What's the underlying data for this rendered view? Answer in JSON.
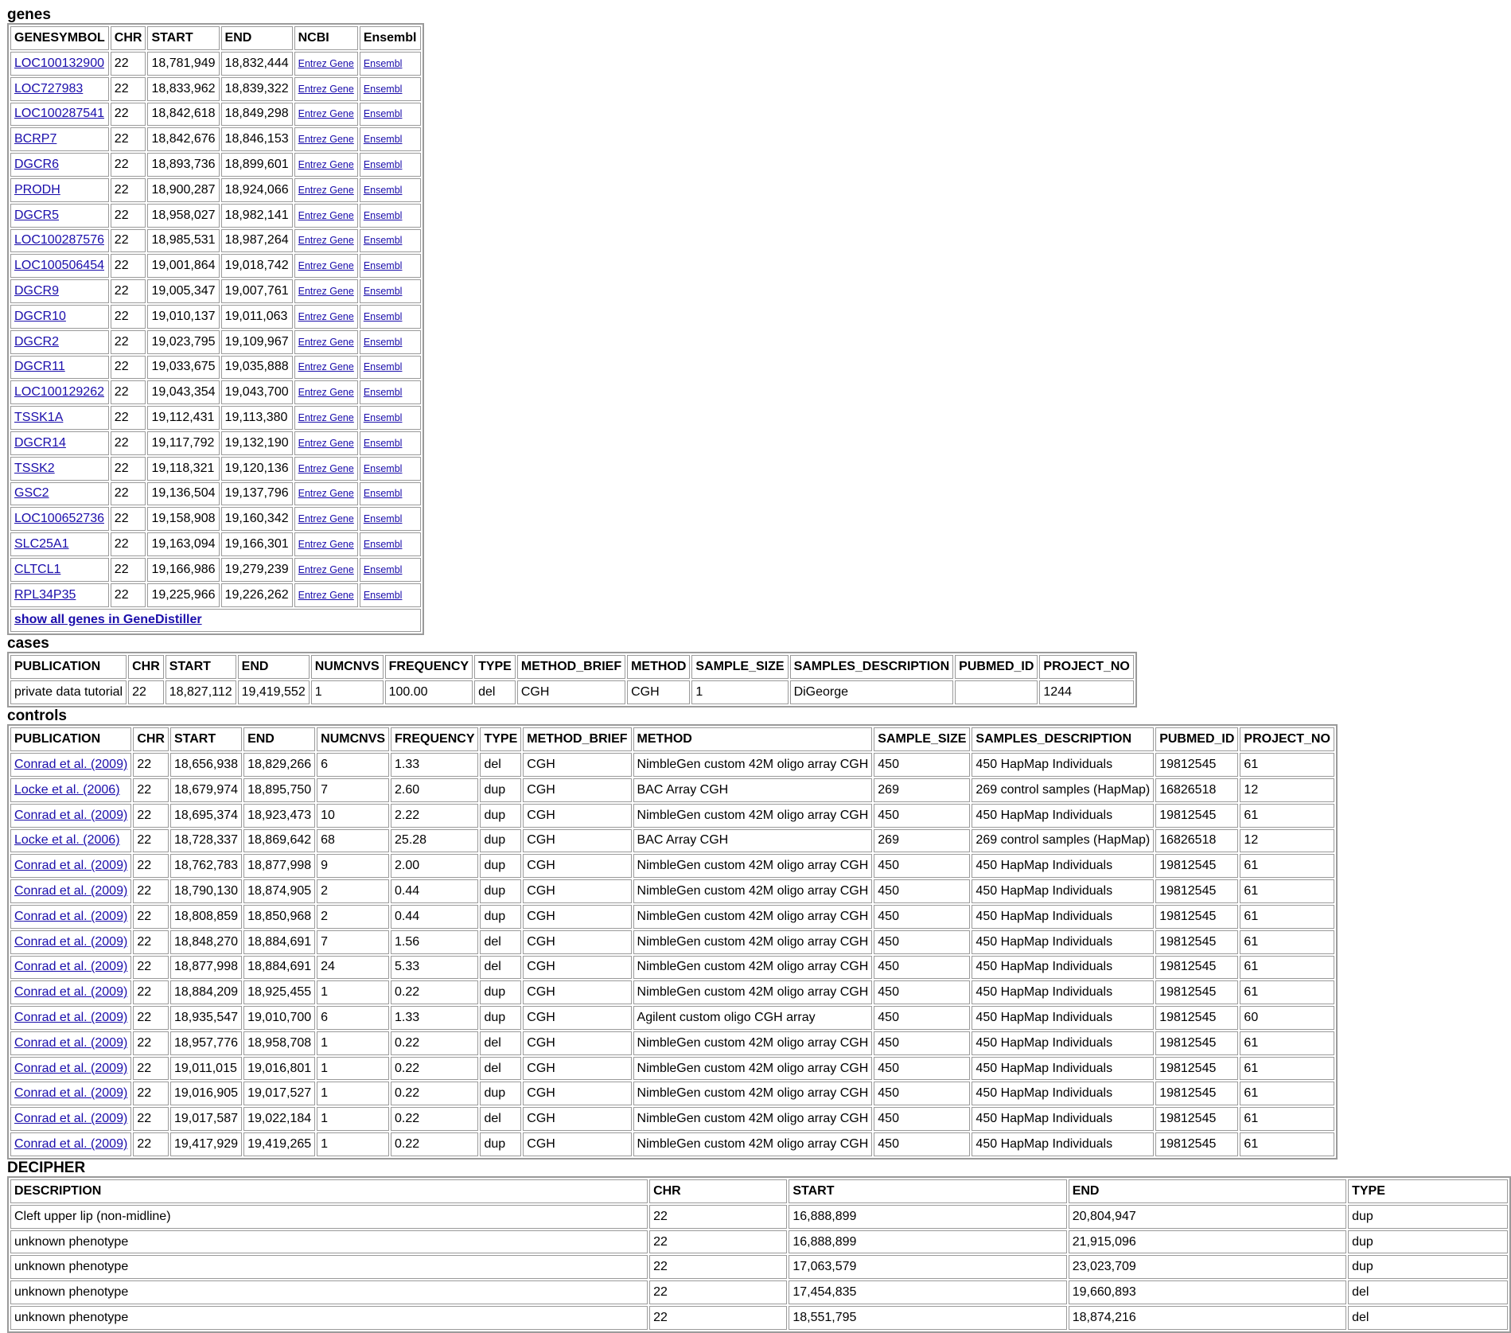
{
  "genes": {
    "title": "genes",
    "headers": [
      "GENESYMBOL",
      "CHR",
      "START",
      "END",
      "NCBI",
      "Ensembl"
    ],
    "rows": [
      {
        "symbol": "LOC100132900",
        "chr": "22",
        "start": "18,781,949",
        "end": "18,832,444",
        "ncbi": "Entrez Gene",
        "ensembl": "Ensembl"
      },
      {
        "symbol": "LOC727983",
        "chr": "22",
        "start": "18,833,962",
        "end": "18,839,322",
        "ncbi": "Entrez Gene",
        "ensembl": "Ensembl"
      },
      {
        "symbol": "LOC100287541",
        "chr": "22",
        "start": "18,842,618",
        "end": "18,849,298",
        "ncbi": "Entrez Gene",
        "ensembl": "Ensembl"
      },
      {
        "symbol": "BCRP7",
        "chr": "22",
        "start": "18,842,676",
        "end": "18,846,153",
        "ncbi": "Entrez Gene",
        "ensembl": "Ensembl"
      },
      {
        "symbol": "DGCR6",
        "chr": "22",
        "start": "18,893,736",
        "end": "18,899,601",
        "ncbi": "Entrez Gene",
        "ensembl": "Ensembl"
      },
      {
        "symbol": "PRODH",
        "chr": "22",
        "start": "18,900,287",
        "end": "18,924,066",
        "ncbi": "Entrez Gene",
        "ensembl": "Ensembl"
      },
      {
        "symbol": "DGCR5",
        "chr": "22",
        "start": "18,958,027",
        "end": "18,982,141",
        "ncbi": "Entrez Gene",
        "ensembl": "Ensembl"
      },
      {
        "symbol": "LOC100287576",
        "chr": "22",
        "start": "18,985,531",
        "end": "18,987,264",
        "ncbi": "Entrez Gene",
        "ensembl": "Ensembl"
      },
      {
        "symbol": "LOC100506454",
        "chr": "22",
        "start": "19,001,864",
        "end": "19,018,742",
        "ncbi": "Entrez Gene",
        "ensembl": "Ensembl"
      },
      {
        "symbol": "DGCR9",
        "chr": "22",
        "start": "19,005,347",
        "end": "19,007,761",
        "ncbi": "Entrez Gene",
        "ensembl": "Ensembl"
      },
      {
        "symbol": "DGCR10",
        "chr": "22",
        "start": "19,010,137",
        "end": "19,011,063",
        "ncbi": "Entrez Gene",
        "ensembl": "Ensembl"
      },
      {
        "symbol": "DGCR2",
        "chr": "22",
        "start": "19,023,795",
        "end": "19,109,967",
        "ncbi": "Entrez Gene",
        "ensembl": "Ensembl"
      },
      {
        "symbol": "DGCR11",
        "chr": "22",
        "start": "19,033,675",
        "end": "19,035,888",
        "ncbi": "Entrez Gene",
        "ensembl": "Ensembl"
      },
      {
        "symbol": "LOC100129262",
        "chr": "22",
        "start": "19,043,354",
        "end": "19,043,700",
        "ncbi": "Entrez Gene",
        "ensembl": "Ensembl"
      },
      {
        "symbol": "TSSK1A",
        "chr": "22",
        "start": "19,112,431",
        "end": "19,113,380",
        "ncbi": "Entrez Gene",
        "ensembl": "Ensembl"
      },
      {
        "symbol": "DGCR14",
        "chr": "22",
        "start": "19,117,792",
        "end": "19,132,190",
        "ncbi": "Entrez Gene",
        "ensembl": "Ensembl"
      },
      {
        "symbol": "TSSK2",
        "chr": "22",
        "start": "19,118,321",
        "end": "19,120,136",
        "ncbi": "Entrez Gene",
        "ensembl": "Ensembl"
      },
      {
        "symbol": "GSC2",
        "chr": "22",
        "start": "19,136,504",
        "end": "19,137,796",
        "ncbi": "Entrez Gene",
        "ensembl": "Ensembl"
      },
      {
        "symbol": "LOC100652736",
        "chr": "22",
        "start": "19,158,908",
        "end": "19,160,342",
        "ncbi": "Entrez Gene",
        "ensembl": "Ensembl"
      },
      {
        "symbol": "SLC25A1",
        "chr": "22",
        "start": "19,163,094",
        "end": "19,166,301",
        "ncbi": "Entrez Gene",
        "ensembl": "Ensembl"
      },
      {
        "symbol": "CLTCL1",
        "chr": "22",
        "start": "19,166,986",
        "end": "19,279,239",
        "ncbi": "Entrez Gene",
        "ensembl": "Ensembl"
      },
      {
        "symbol": "RPL34P35",
        "chr": "22",
        "start": "19,225,966",
        "end": "19,226,262",
        "ncbi": "Entrez Gene",
        "ensembl": "Ensembl"
      }
    ],
    "show_all_label": "show all genes in GeneDistiller"
  },
  "cases": {
    "title": "cases",
    "headers": [
      "PUBLICATION",
      "CHR",
      "START",
      "END",
      "NUMCNVS",
      "FREQUENCY",
      "TYPE",
      "METHOD_BRIEF",
      "METHOD",
      "SAMPLE_SIZE",
      "SAMPLES_DESCRIPTION",
      "PUBMED_ID",
      "PROJECT_NO"
    ],
    "rows": [
      [
        "private data tutorial",
        "22",
        "18,827,112",
        "19,419,552",
        "1",
        "100.00",
        "del",
        "CGH",
        "CGH",
        "1",
        "DiGeorge",
        "",
        "1244"
      ]
    ]
  },
  "controls": {
    "title": "controls",
    "headers": [
      "PUBLICATION",
      "CHR",
      "START",
      "END",
      "NUMCNVS",
      "FREQUENCY",
      "TYPE",
      "METHOD_BRIEF",
      "METHOD",
      "SAMPLE_SIZE",
      "SAMPLES_DESCRIPTION",
      "PUBMED_ID",
      "PROJECT_NO"
    ],
    "rows": [
      [
        "Conrad et al. (2009)",
        "22",
        "18,656,938",
        "18,829,266",
        "6",
        "1.33",
        "del",
        "CGH",
        "NimbleGen custom 42M oligo array CGH",
        "450",
        "450 HapMap Individuals",
        "19812545",
        "61"
      ],
      [
        "Locke et al. (2006)",
        "22",
        "18,679,974",
        "18,895,750",
        "7",
        "2.60",
        "dup",
        "CGH",
        "BAC Array CGH",
        "269",
        "269 control samples (HapMap)",
        "16826518",
        "12"
      ],
      [
        "Conrad et al. (2009)",
        "22",
        "18,695,374",
        "18,923,473",
        "10",
        "2.22",
        "dup",
        "CGH",
        "NimbleGen custom 42M oligo array CGH",
        "450",
        "450 HapMap Individuals",
        "19812545",
        "61"
      ],
      [
        "Locke et al. (2006)",
        "22",
        "18,728,337",
        "18,869,642",
        "68",
        "25.28",
        "dup",
        "CGH",
        "BAC Array CGH",
        "269",
        "269 control samples (HapMap)",
        "16826518",
        "12"
      ],
      [
        "Conrad et al. (2009)",
        "22",
        "18,762,783",
        "18,877,998",
        "9",
        "2.00",
        "dup",
        "CGH",
        "NimbleGen custom 42M oligo array CGH",
        "450",
        "450 HapMap Individuals",
        "19812545",
        "61"
      ],
      [
        "Conrad et al. (2009)",
        "22",
        "18,790,130",
        "18,874,905",
        "2",
        "0.44",
        "dup",
        "CGH",
        "NimbleGen custom 42M oligo array CGH",
        "450",
        "450 HapMap Individuals",
        "19812545",
        "61"
      ],
      [
        "Conrad et al. (2009)",
        "22",
        "18,808,859",
        "18,850,968",
        "2",
        "0.44",
        "dup",
        "CGH",
        "NimbleGen custom 42M oligo array CGH",
        "450",
        "450 HapMap Individuals",
        "19812545",
        "61"
      ],
      [
        "Conrad et al. (2009)",
        "22",
        "18,848,270",
        "18,884,691",
        "7",
        "1.56",
        "del",
        "CGH",
        "NimbleGen custom 42M oligo array CGH",
        "450",
        "450 HapMap Individuals",
        "19812545",
        "61"
      ],
      [
        "Conrad et al. (2009)",
        "22",
        "18,877,998",
        "18,884,691",
        "24",
        "5.33",
        "del",
        "CGH",
        "NimbleGen custom 42M oligo array CGH",
        "450",
        "450 HapMap Individuals",
        "19812545",
        "61"
      ],
      [
        "Conrad et al. (2009)",
        "22",
        "18,884,209",
        "18,925,455",
        "1",
        "0.22",
        "dup",
        "CGH",
        "NimbleGen custom 42M oligo array CGH",
        "450",
        "450 HapMap Individuals",
        "19812545",
        "61"
      ],
      [
        "Conrad et al. (2009)",
        "22",
        "18,935,547",
        "19,010,700",
        "6",
        "1.33",
        "dup",
        "CGH",
        "Agilent custom oligo CGH array",
        "450",
        "450 HapMap Individuals",
        "19812545",
        "60"
      ],
      [
        "Conrad et al. (2009)",
        "22",
        "18,957,776",
        "18,958,708",
        "1",
        "0.22",
        "del",
        "CGH",
        "NimbleGen custom 42M oligo array CGH",
        "450",
        "450 HapMap Individuals",
        "19812545",
        "61"
      ],
      [
        "Conrad et al. (2009)",
        "22",
        "19,011,015",
        "19,016,801",
        "1",
        "0.22",
        "del",
        "CGH",
        "NimbleGen custom 42M oligo array CGH",
        "450",
        "450 HapMap Individuals",
        "19812545",
        "61"
      ],
      [
        "Conrad et al. (2009)",
        "22",
        "19,016,905",
        "19,017,527",
        "1",
        "0.22",
        "dup",
        "CGH",
        "NimbleGen custom 42M oligo array CGH",
        "450",
        "450 HapMap Individuals",
        "19812545",
        "61"
      ],
      [
        "Conrad et al. (2009)",
        "22",
        "19,017,587",
        "19,022,184",
        "1",
        "0.22",
        "del",
        "CGH",
        "NimbleGen custom 42M oligo array CGH",
        "450",
        "450 HapMap Individuals",
        "19812545",
        "61"
      ],
      [
        "Conrad et al. (2009)",
        "22",
        "19,417,929",
        "19,419,265",
        "1",
        "0.22",
        "dup",
        "CGH",
        "NimbleGen custom 42M oligo array CGH",
        "450",
        "450 HapMap Individuals",
        "19812545",
        "61"
      ]
    ]
  },
  "decipher": {
    "title": "DECIPHER",
    "headers": [
      "DESCRIPTION",
      "CHR",
      "START",
      "END",
      "TYPE"
    ],
    "rows": [
      [
        "Cleft upper lip (non-midline)",
        "22",
        "16,888,899",
        "20,804,947",
        "dup"
      ],
      [
        "unknown phenotype",
        "22",
        "16,888,899",
        "21,915,096",
        "dup"
      ],
      [
        "unknown phenotype",
        "22",
        "17,063,579",
        "23,023,709",
        "dup"
      ],
      [
        "unknown phenotype",
        "22",
        "17,454,835",
        "19,660,893",
        "del"
      ],
      [
        "unknown phenotype",
        "22",
        "18,551,795",
        "18,874,216",
        "del"
      ]
    ]
  },
  "colors": {
    "link": "#1a0dab",
    "border": "#9a9a9a",
    "text": "#000000"
  }
}
